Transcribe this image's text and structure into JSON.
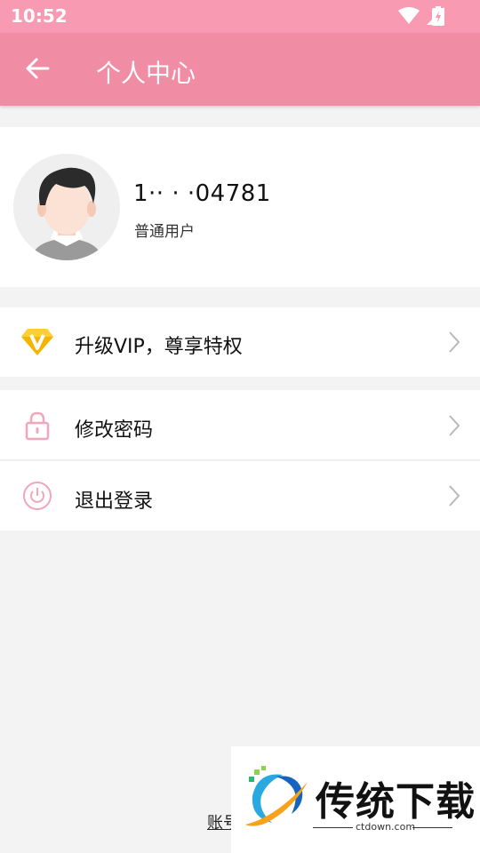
{
  "status_bar": {
    "time": "10:52",
    "icons": [
      "wifi-icon",
      "signal-icon",
      "battery-icon"
    ]
  },
  "app_bar": {
    "back_icon": "arrow-left-icon",
    "title": "个人中心"
  },
  "profile": {
    "avatar": "avatar-illustration",
    "username": "1··  ·  ·04781",
    "level": "普通用户"
  },
  "menu": {
    "vip": {
      "icon": "vip-diamond-icon",
      "label": "升级VIP，尊享特权"
    },
    "password": {
      "icon": "lock-icon",
      "label": "修改密码"
    },
    "logout": {
      "icon": "power-icon",
      "label": "退出登录"
    },
    "chevron_icon": "chevron-right-icon"
  },
  "footer": {
    "text": "账号"
  },
  "watermark": {
    "brand": "传统下载",
    "site": "ctdown.com"
  },
  "colors": {
    "status_bar": "#f79ab2",
    "app_bar": "#f08ca3",
    "vip_gold": "#f5b400",
    "icon_pink": "#f2a6bb",
    "page_bg": "#f3f3f3"
  }
}
